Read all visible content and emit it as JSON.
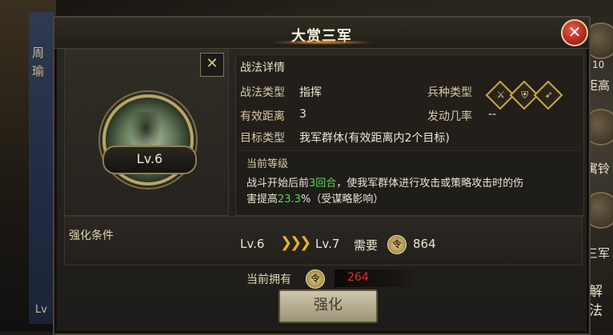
{
  "background": {
    "left_chars": [
      "周",
      "瑜"
    ],
    "left_bottom": "Lv",
    "right_labels": [
      "距高",
      "寓铃",
      "三军",
      "解",
      "法"
    ],
    "right_number": "10"
  },
  "dialog": {
    "title": "大赏三军",
    "close_icon": "close-icon"
  },
  "skill": {
    "level": "Lv.6",
    "icon": "tactic-portrait"
  },
  "details": {
    "header": "战法详情",
    "type_label": "战法类型",
    "type_value": "指挥",
    "arms_label": "兵种类型",
    "arms_icons": [
      "cavalry-icon",
      "shield-icon",
      "archer-icon"
    ],
    "range_label": "有效距离",
    "range_value": "3",
    "rate_label": "发动几率",
    "rate_value": "--",
    "target_label": "目标类型",
    "target_value": "我军群体(有效距离内2个目标)"
  },
  "description": {
    "level_header": "当前等级",
    "line1_a": "战斗开始后前",
    "line1_highlight": "3回合",
    "line1_b": "，使我军群体进行攻击或策略攻击时的伤",
    "line2_a": "害提高",
    "line2_highlight": "23.3",
    "line2_b": "%（受谋略影响）"
  },
  "upgrade": {
    "label": "强化条件",
    "current_level": "Lv.6",
    "next_level": "Lv.7",
    "need_label": "需要",
    "need_value": "864",
    "own_label": "当前拥有",
    "own_value": "264",
    "button_label": "强化"
  },
  "colors": {
    "accent_gold": "#e6b22c",
    "highlight_green": "#5ed45a",
    "insufficient_red": "#e03030",
    "close_red": "#c83426"
  }
}
